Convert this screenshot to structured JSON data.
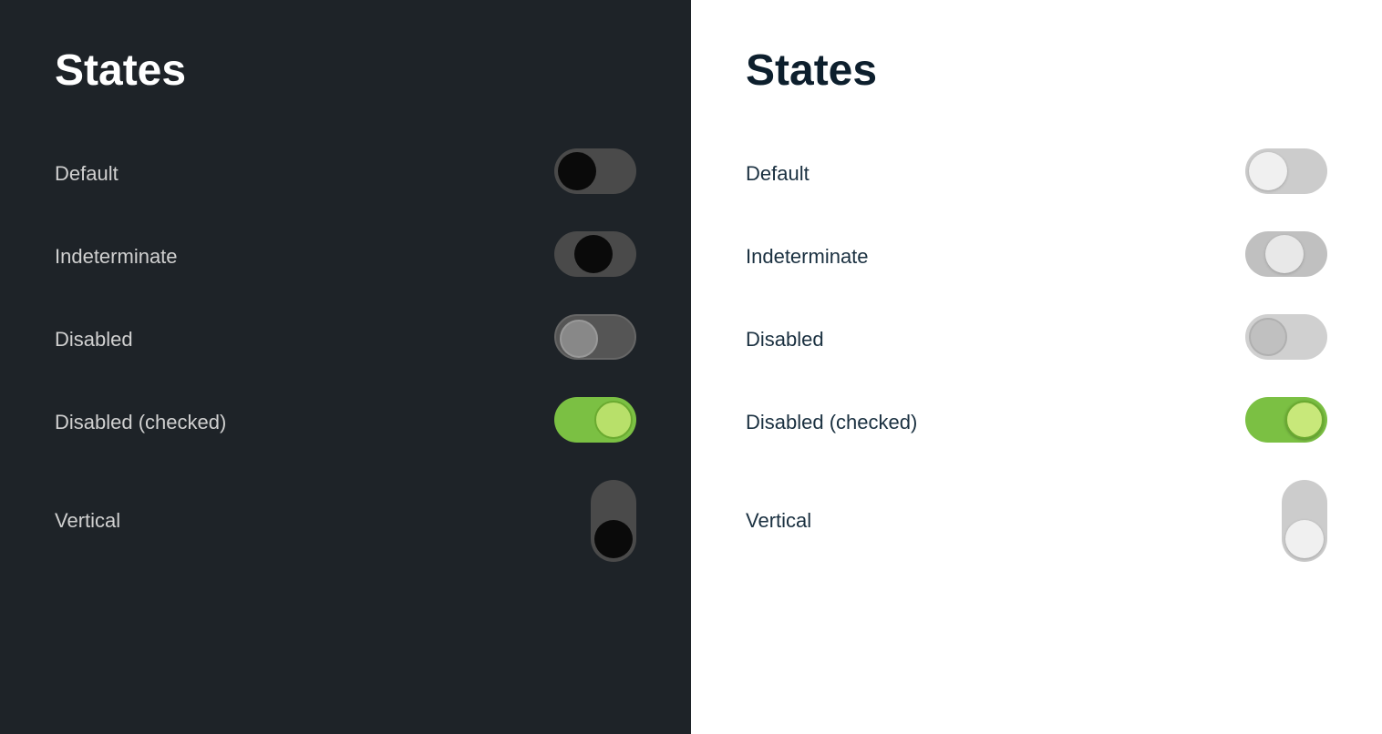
{
  "dark_panel": {
    "title": "States",
    "states": [
      {
        "label": "Default",
        "type": "default"
      },
      {
        "label": "Indeterminate",
        "type": "indeterminate"
      },
      {
        "label": "Disabled",
        "type": "disabled"
      },
      {
        "label": "Disabled (checked)",
        "type": "disabled-checked"
      },
      {
        "label": "Vertical",
        "type": "vertical"
      }
    ]
  },
  "light_panel": {
    "title": "States",
    "states": [
      {
        "label": "Default",
        "type": "default"
      },
      {
        "label": "Indeterminate",
        "type": "indeterminate"
      },
      {
        "label": "Disabled",
        "type": "disabled"
      },
      {
        "label": "Disabled (checked)",
        "type": "disabled-checked"
      },
      {
        "label": "Vertical",
        "type": "vertical"
      }
    ]
  }
}
